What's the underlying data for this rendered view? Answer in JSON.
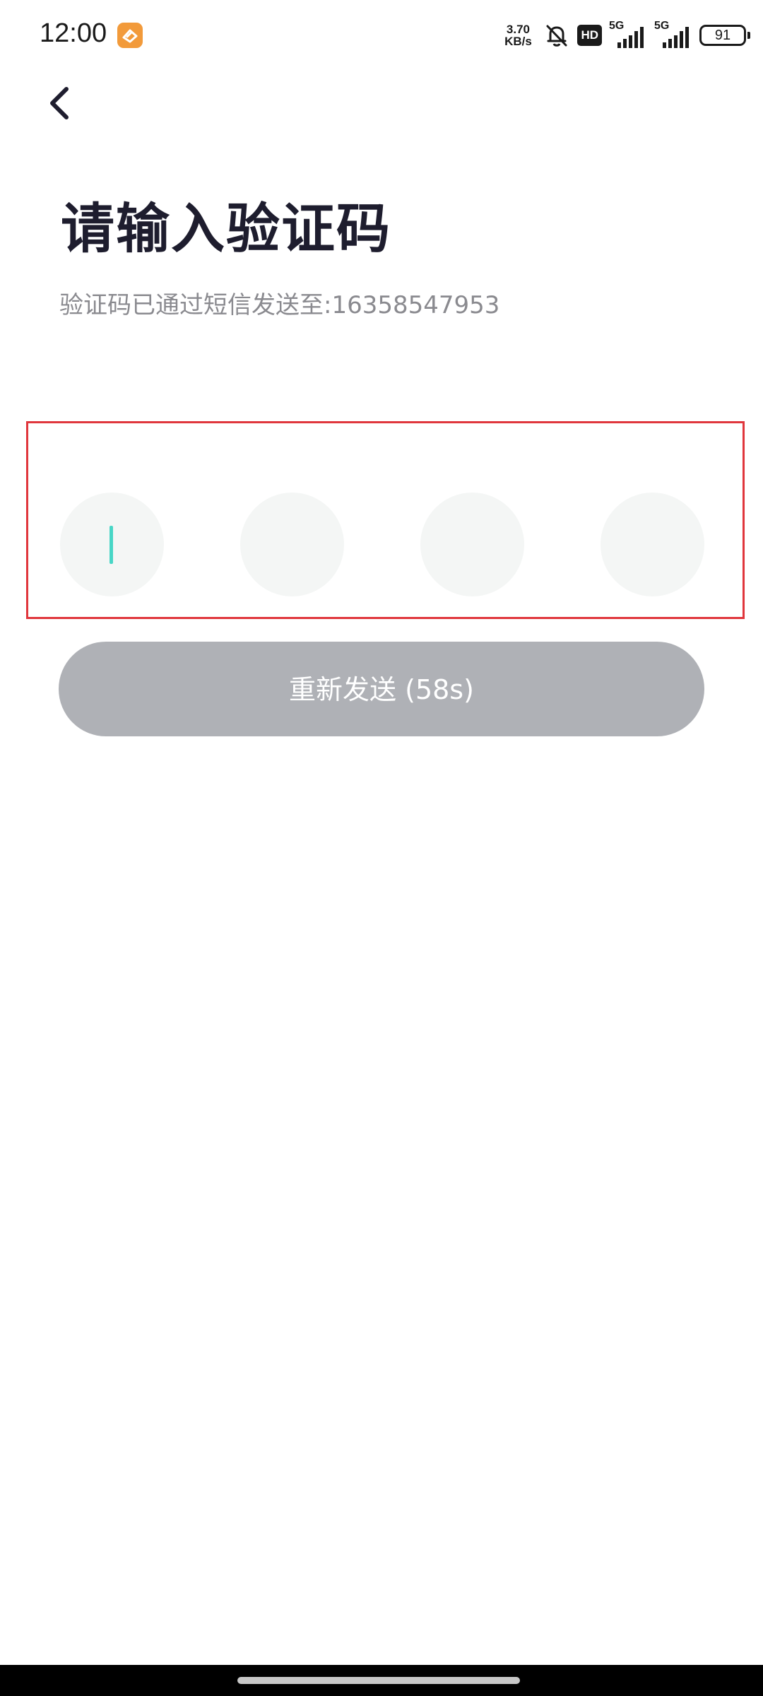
{
  "status_bar": {
    "time": "12:00",
    "app_notification_icon": "orange-app-icon",
    "net_speed_value": "3.70",
    "net_speed_unit": "KB/s",
    "silent_icon": "bell-off-icon",
    "hd_label": "HD",
    "signal_1_label": "5G",
    "signal_2_label": "5G",
    "battery": "91"
  },
  "header": {
    "back_icon": "chevron-left-icon",
    "title": "请输入验证码",
    "subtitle": "验证码已通过短信发送至:16358547953"
  },
  "code_input": {
    "cells": [
      "",
      "",
      "",
      ""
    ],
    "active_index": 0,
    "cursor_color": "#48d6c6",
    "cell_color": "#f4f6f5",
    "highlight_border_color": "#e0363c"
  },
  "resend_button": {
    "label": "重新发送 (58s)",
    "color": "#afb1b6",
    "text_color": "#ffffff"
  }
}
